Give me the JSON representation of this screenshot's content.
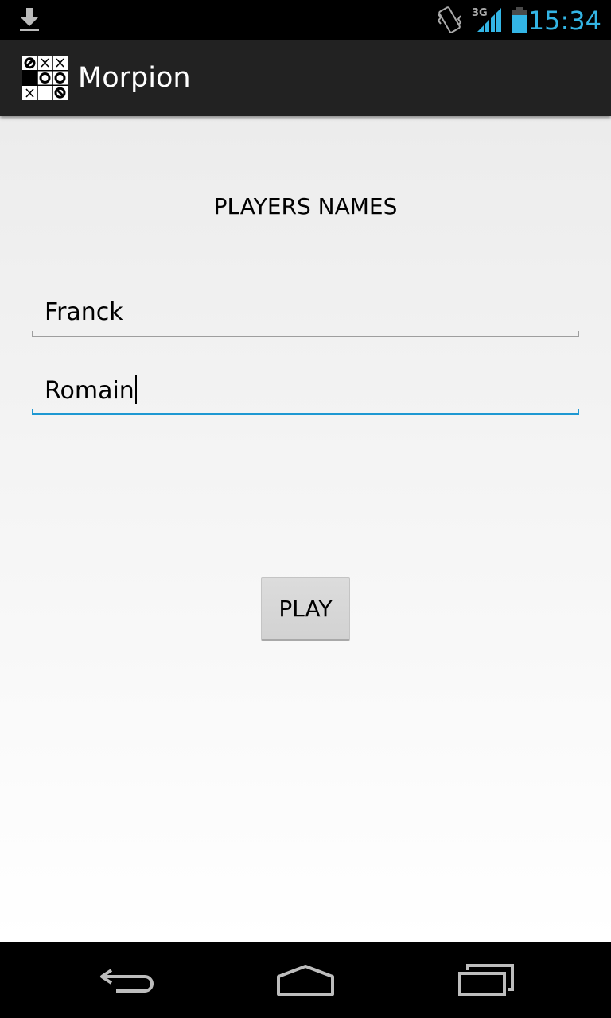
{
  "status_bar": {
    "time": "15:34",
    "network_type": "3G",
    "time_color": "#33b5e5",
    "icons": [
      "download-icon",
      "vibrate-icon",
      "signal-icon",
      "battery-icon"
    ]
  },
  "action_bar": {
    "title": "Morpion",
    "icon": "tic-tac-toe-icon"
  },
  "main": {
    "heading": "PLAYERS NAMES",
    "player1": {
      "value": "Franck"
    },
    "player2": {
      "value": "Romain",
      "focused": true
    },
    "play_button": "PLAY"
  },
  "nav_bar": {
    "icons": [
      "back-icon",
      "home-icon",
      "recent-apps-icon"
    ]
  },
  "colors": {
    "accent": "#33b5e5",
    "focused_underline": "#1e98d2",
    "action_bar_bg": "#222222"
  }
}
